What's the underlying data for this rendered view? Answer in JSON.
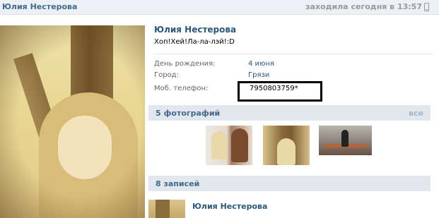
{
  "header": {
    "name": "Юлия Нестерова",
    "last_seen": "заходила сегодня в 13:57",
    "mobile_icon": "phone-icon"
  },
  "profile": {
    "name": "Юлия Нестерова",
    "status": "Хоп!Хей!Ла-ла-лэй!:D",
    "fields": [
      {
        "label": "День рождения:",
        "value": "4 июня"
      },
      {
        "label": "Город:",
        "value": "Грязи"
      },
      {
        "label": "Моб. телефон:",
        "value": "7950803759*"
      }
    ]
  },
  "photos_section": {
    "title": "5 фотографий",
    "all_link": "все"
  },
  "posts_section": {
    "title": "8 записей",
    "first_post_author": "Юлия Нестерова"
  }
}
